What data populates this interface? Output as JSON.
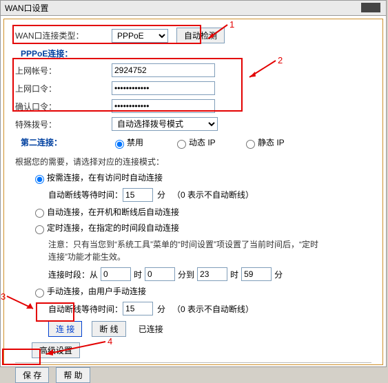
{
  "title": "WAN口设置",
  "wan": {
    "type_label": "WAN口连接类型：",
    "type_value": "PPPoE",
    "autodetect_btn": "自动检测"
  },
  "pppoe": {
    "section": "PPPoE连接：",
    "account_label": "上网帐号：",
    "account_value": "2924752",
    "password_label": "上网口令：",
    "password_value": "••••••••••••",
    "confirm_label": "确认口令：",
    "confirm_value": "••••••••••••",
    "special_label": "特殊拨号：",
    "special_value": "自动选择拨号模式"
  },
  "second_conn": {
    "label": "第二连接：",
    "disable": "禁用",
    "dynamic": "动态 IP",
    "static": "静态 IP"
  },
  "mode_desc": "根据您的需要，请选择对应的连接模式：",
  "modes": {
    "on_demand": "按需连接，在有访问时自动连接",
    "on_demand_wait_label": "自动断线等待时间：",
    "on_demand_wait_value": "15",
    "minutes": "分",
    "zero_hint": "（0 表示不自动断线）",
    "auto": "自动连接，在开机和断线后自动连接",
    "scheduled": "定时连接，在指定的时间段自动连接",
    "scheduled_note": "注意：只有当您到“系统工具”菜单的“时间设置”项设置了当前时间后，“定时连接”功能才能生效。",
    "time_label": "连接时段：从",
    "h": "时",
    "m": "分到",
    "from_h": "0",
    "from_m": "0",
    "to_h": "23",
    "to_m": "59",
    "to_min_label": "分",
    "manual": "手动连接，由用户手动连接",
    "manual_wait_label": "自动断线等待时间：",
    "manual_wait_value": "15"
  },
  "buttons": {
    "connect": "连 接",
    "disconnect": "断 线",
    "status": "已连接",
    "advanced": "高级设置",
    "save": "保 存",
    "help": "帮 助"
  },
  "annotations": {
    "n1": "1",
    "n2": "2",
    "n3": "3",
    "n4": "4"
  }
}
